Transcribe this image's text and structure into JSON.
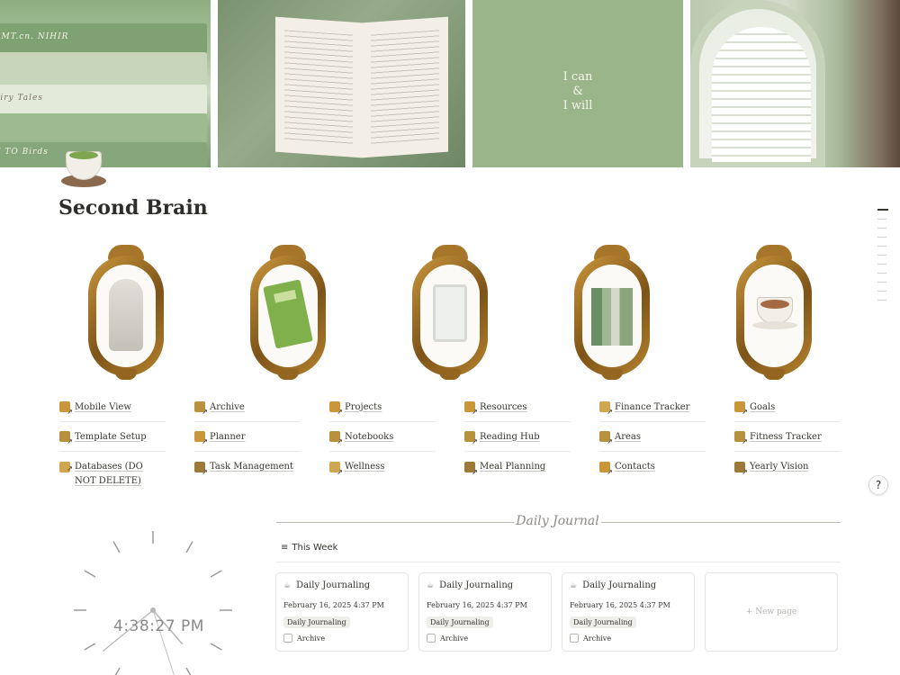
{
  "cover": {
    "book_spines": [
      "AMT.cn. NIHIR",
      "airy Tales",
      "E TO Birds"
    ],
    "quote_lines": [
      "I can",
      "&",
      "I will"
    ]
  },
  "page": {
    "icon": "matcha-cup-icon",
    "title": "Second Brain"
  },
  "frames": [
    "statue-bust",
    "green-notebook",
    "tablet",
    "book-stack",
    "latte-cup"
  ],
  "links": [
    [
      {
        "label": "Mobile View",
        "color": "#c99739"
      },
      {
        "label": "Template Setup",
        "color": "#b8913f"
      },
      {
        "label": "Databases (DO NOT DELETE)",
        "color": "#d1a650"
      }
    ],
    [
      {
        "label": "Archive",
        "color": "#b8913f"
      },
      {
        "label": "Planner",
        "color": "#c99739"
      },
      {
        "label": "Task Management",
        "color": "#9e7a3a"
      }
    ],
    [
      {
        "label": "Projects",
        "color": "#c99739"
      },
      {
        "label": "Notebooks",
        "color": "#b8913f"
      },
      {
        "label": "Wellness",
        "color": "#d1a650"
      }
    ],
    [
      {
        "label": "Resources",
        "color": "#c99739"
      },
      {
        "label": "Reading Hub",
        "color": "#b8913f"
      },
      {
        "label": "Meal Planning",
        "color": "#9e7a3a"
      }
    ],
    [
      {
        "label": "Finance Tracker",
        "color": "#d1a650"
      },
      {
        "label": "Areas",
        "color": "#b8913f"
      },
      {
        "label": "Contacts",
        "color": "#c99739"
      }
    ],
    [
      {
        "label": "Goals",
        "color": "#c99739"
      },
      {
        "label": "Fitness Tracker",
        "color": "#b8913f"
      },
      {
        "label": "Yearly Vision",
        "color": "#9e7a3a"
      }
    ]
  ],
  "clock": {
    "time": "4:38:27 PM",
    "hour": 4,
    "minute": 38,
    "second": 27
  },
  "journal": {
    "title": "Daily Journal",
    "view_label": "This Week",
    "cards": [
      {
        "title": "Daily Journaling",
        "date": "February 16, 2025 4:37 PM",
        "tag": "Daily Journaling",
        "checkbox_label": "Archive"
      },
      {
        "title": "Daily Journaling",
        "date": "February 16, 2025 4:37 PM",
        "tag": "Daily Journaling",
        "checkbox_label": "Archive"
      },
      {
        "title": "Daily Journaling",
        "date": "February 16, 2025 4:37 PM",
        "tag": "Daily Journaling",
        "checkbox_label": "Archive"
      }
    ],
    "new_page_label": "New page"
  },
  "help": {
    "icon": "help-question-icon",
    "glyph": "?"
  }
}
